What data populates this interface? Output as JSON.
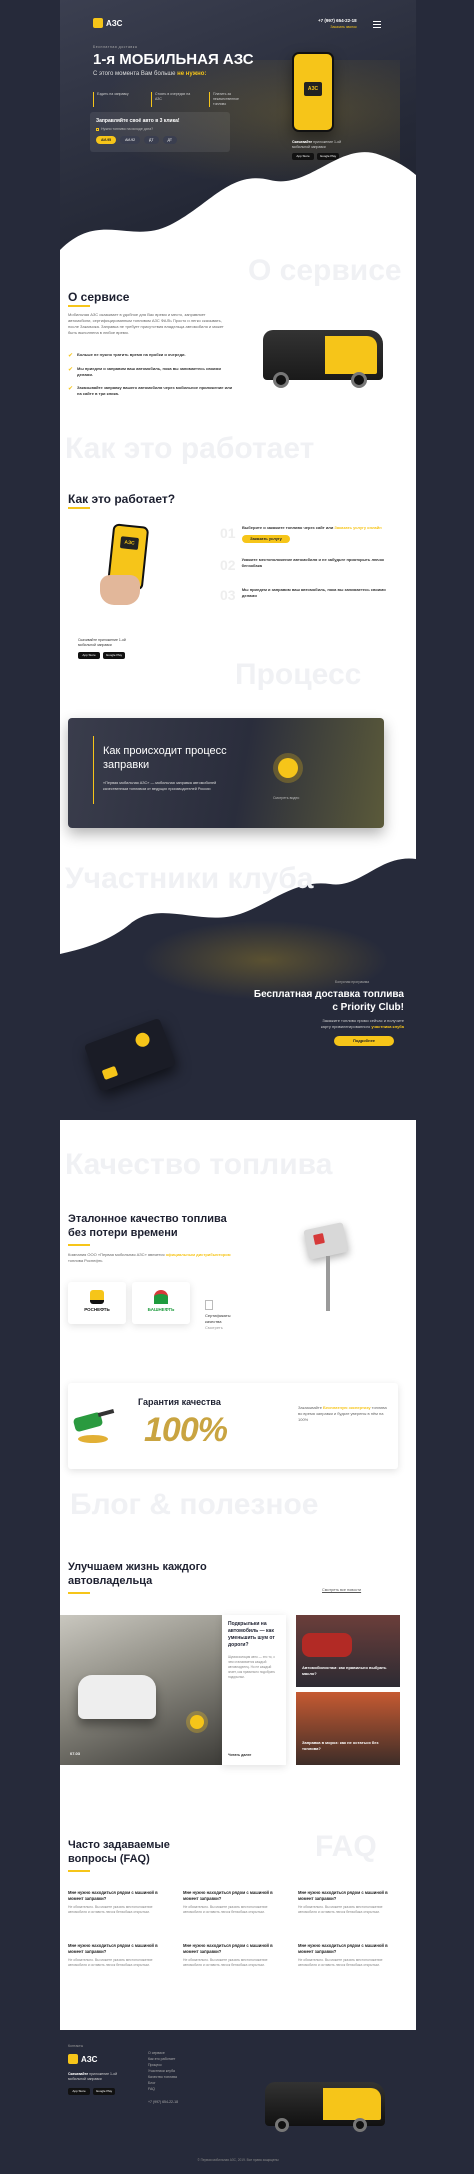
{
  "header": {
    "logo_text": "АЗС",
    "phone": "+7 (997) 654-22-18",
    "callback": "Заказать звонок",
    "menu_icon": "hamburger-icon"
  },
  "hero": {
    "eyebrow": "Бесплатная доставка",
    "title": "1-я МОБИЛЬНАЯ АЗС",
    "subtitle_prefix": "С этого момента Вам больше ",
    "subtitle_highlight": "не нужно:",
    "benefits": [
      "Ездить на заправку",
      "Стоять в очередях на АЗС",
      "Платить за некачественное топливо"
    ],
    "order_title": "Заправляйте своё авто в 3 клика!",
    "order_option": "Нужно топливо на исходе дата?",
    "fuel_types": [
      "АИ-95",
      "АИ-92",
      "ДТ",
      "ДТ"
    ],
    "app_caption_bold": "Скачивайте",
    "app_caption": "приложение 1-ой мобильной заправки",
    "phone_logo": "АЗС"
  },
  "about": {
    "ghost": "О сервисе",
    "title": "О сервисе",
    "text": "Мобильная АЗС оказывает в удобное для Вас время и место, заправляет автомобили, сертифицированным топливом АЗС ФАЛЬ Просто и легко сказывать, после Заказчика. Заправка не требует присутствия владельца автомобиля и может быть выполнена в любое время.",
    "items": [
      "Больше не нужно тратить время на пробки и очереди.",
      "Мы приедем и заправим ваш автомобиль, пока вы занимаетесь своими делами.",
      "Заказывайте заправку вашего автомобиля через мобильное приложение или на сайте в три клика."
    ]
  },
  "how": {
    "ghost": "Как это работает",
    "title": "Как это работает?",
    "steps": [
      {
        "num": "01",
        "text": "Выберите и закажите топливо через сайт или ",
        "link": "Заказать услугу онлайн",
        "button": "Заказать услугу"
      },
      {
        "num": "02",
        "text": "Укажите местоположение автомобиля и не забудьте приоткрыть лючок бензобака"
      },
      {
        "num": "03",
        "text": "Мы приедем и заправим ваш автомобиль, пока вы занимаетесь своими делами"
      }
    ],
    "app_caption": "Скачивайте приложение 1-ой мобильной заправки",
    "phone_logo": "АЗС"
  },
  "process": {
    "ghost": "Процесс",
    "title": "Как происходит процесс заправки",
    "text": "«Первая мобильная АЗС» — мобильная заправка автомобилей качественным топливом от ведущих производителей России",
    "play_label": "Смотреть видео"
  },
  "club": {
    "ghost": "Участники клуба",
    "eyebrow": "Бонусная программа",
    "title_line1": "Бесплатная доставка топлива",
    "title_line2": "с Priority Club!",
    "text_line1": "Закажите топливо прямо сейчас и получите",
    "text_line2": "карту привилегированного ",
    "text_highlight": "участника клуба",
    "button": "Подробнее"
  },
  "quality": {
    "ghost": "Качество топлива",
    "title_line1": "Эталонное качество топлива",
    "title_line2": "без потери времени",
    "text_prefix": "Компания ООО «Первая мобильная АЗС» является ",
    "text_highlight": "официальным дистрибьютором",
    "text_suffix": " топлива Роснефть",
    "brands": [
      "РОСНЕФТЬ",
      "БАШНЕФТЬ"
    ],
    "cert_label": "Сертификаты качества",
    "cert_link": "Смотреть",
    "guarantee_title": "Гарантия качества",
    "guarantee_percent": "100%",
    "guarantee_text_prefix": "Заказывайте ",
    "guarantee_highlight": "Бесплатную экспертизу",
    "guarantee_text_suffix": " топлива во время заправки и будьте уверены в нём на 100%"
  },
  "blog": {
    "ghost": "Блог & полезное",
    "title_line1": "Улучшаем жизнь каждого",
    "title_line2": "автовладельца",
    "all_link": "Смотреть все новости",
    "main_post": {
      "title": "Подкрыльки на автомобиль — как уменьшить шум от дороги?",
      "text": "Шумоизоляция авто — это то, с чем сталкивается каждый автовладелец. Но не каждый знает, как правильно подобрать подкрылки.",
      "more": "Читать далее",
      "date": "07.03"
    },
    "side_posts": [
      "Автомобилистам: как правильно выбрать масло?",
      "Заправка в мороз: как не остаться без топлива?"
    ]
  },
  "faq": {
    "ghost": "FAQ",
    "title_line1": "Часто задаваемые",
    "title_line2": "вопросы (FAQ)",
    "items": [
      {
        "q": "Мне нужно находиться рядом с машиной в момент заправки?",
        "a": "Не обязательно. Вы можете указать местоположение автомобиля и оставить лючок бензобака открытым."
      },
      {
        "q": "Мне нужно находиться рядом с машиной в момент заправки?",
        "a": "Не обязательно. Вы можете указать местоположение автомобиля и оставить лючок бензобака открытым."
      },
      {
        "q": "Мне нужно находиться рядом с машиной в момент заправки?",
        "a": "Не обязательно. Вы можете указать местоположение автомобиля и оставить лючок бензобака открытым."
      },
      {
        "q": "Мне нужно находиться рядом с машиной в момент заправки?",
        "a": "Не обязательно. Вы можете указать местоположение автомобиля и оставить лючок бензобака открытым."
      },
      {
        "q": "Мне нужно находиться рядом с машиной в момент заправки?",
        "a": "Не обязательно. Вы можете указать местоположение автомобиля и оставить лючок бензобака открытым."
      },
      {
        "q": "Мне нужно находиться рядом с машиной в момент заправки?",
        "a": "Не обязательно. Вы можете указать местоположение автомобиля и оставить лючок бензобака открытым."
      }
    ]
  },
  "footer": {
    "eyebrow": "Контакты",
    "logo_text": "АЗС",
    "app_bold": "Скачивайте",
    "app_text": "приложение 1-ой мобильной заправки",
    "links": [
      "О сервисе",
      "Как это работает",
      "Процесс",
      "Участники клуба",
      "Качество топлива",
      "Блог",
      "FAQ"
    ],
    "phone": "+7 (997) 654-22-18",
    "copyright": "© Первая мобильная АЗС, 2019. Все права защищены"
  },
  "stores": {
    "apple": "App Store",
    "google": "Google Play"
  },
  "colors": {
    "accent": "#f6c519",
    "dark": "#262a3a",
    "text": "#1d2030"
  }
}
